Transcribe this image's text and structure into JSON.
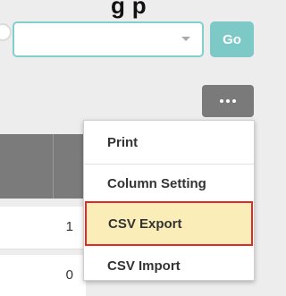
{
  "header": {
    "partial_title": "g  p"
  },
  "search": {
    "placeholder": ""
  },
  "toolbar": {
    "go_label": "Go"
  },
  "table": {
    "rows": [
      {
        "value": "1"
      },
      {
        "value": "0"
      }
    ]
  },
  "menu": {
    "items": [
      {
        "label": "Print"
      },
      {
        "label": "Column Setting"
      },
      {
        "label": "CSV Export"
      },
      {
        "label": "CSV Import"
      }
    ],
    "highlighted": "CSV Export"
  }
}
